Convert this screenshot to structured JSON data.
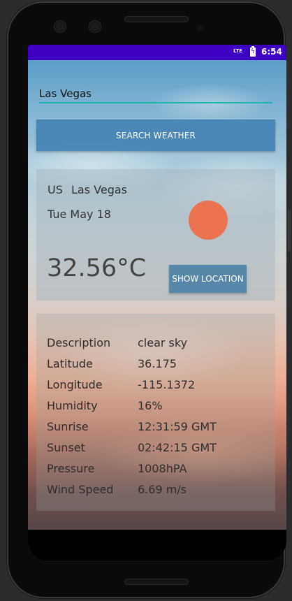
{
  "status_bar": {
    "network": "LTE",
    "time": "6:54"
  },
  "search": {
    "city_value": "Las Vegas",
    "button_label": "SEARCH WEATHER"
  },
  "current": {
    "country": "US",
    "city": "Las Vegas",
    "date": "Tue May 18",
    "temperature": "32.56°C",
    "icon": "sun-icon",
    "icon_color": "#ec7350",
    "location_button": "SHOW LOCATION"
  },
  "details": [
    {
      "label": "Description",
      "value": "clear sky"
    },
    {
      "label": "Latitude",
      "value": "36.175"
    },
    {
      "label": "Longitude",
      "value": "-115.1372"
    },
    {
      "label": "Humidity",
      "value": "16%"
    },
    {
      "label": "Sunrise",
      "value": "12:31:59 GMT"
    },
    {
      "label": "Sunset",
      "value": "02:42:15 GMT"
    },
    {
      "label": "Pressure",
      "value": "1008hPA"
    },
    {
      "label": "Wind Speed",
      "value": "6.69 m/s"
    }
  ],
  "colors": {
    "status_bar": "#3d00c0",
    "accent_underline": "#1bb6ad",
    "button": "#4080b2"
  }
}
